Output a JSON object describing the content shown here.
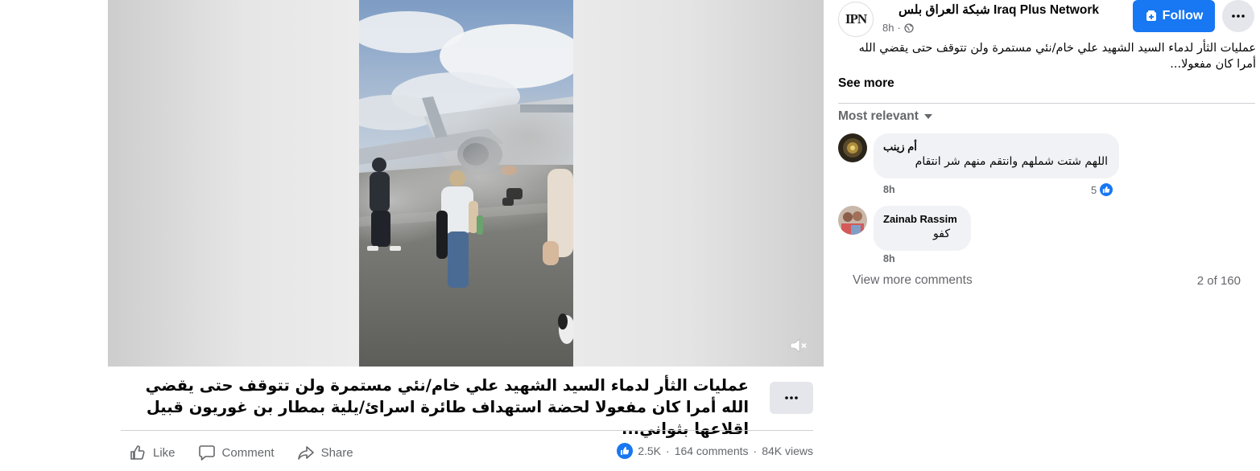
{
  "page": {
    "name": "شبكة العراق بلس Iraq Plus Network",
    "avatar_text": "IPN",
    "time": "8h",
    "audience_icon": "globe-icon"
  },
  "buttons": {
    "follow_label": "Follow",
    "see_more": "See more"
  },
  "post": {
    "text_preview": "عمليات الثأر لدماء السيد الشهيد علي خام/نئي مستمرة ولن تتوقف حتى يقضي الله أمرا كان مفعولا...",
    "caption": "عمليات الثأر لدماء السيد الشهيد علي خام/نئي مستمرة ولن تتوقف حتى يقضي الله أمرا كان مفعولا لحضة استهداف طائرة اسرائ/يلية بمطار بن غوريون قبيل اقلاعها بثواني..."
  },
  "actions": {
    "like": "Like",
    "comment": "Comment",
    "share": "Share"
  },
  "stats": {
    "reactions": "2.5K",
    "comments": "164 comments",
    "views": "84K views",
    "separator": "·"
  },
  "comments_section": {
    "sort_label": "Most relevant",
    "items": [
      {
        "author": "أم زينب",
        "text": "اللهم شتت شملهم وانتقم منهم شر انتقام",
        "time": "8h",
        "reactions": "5"
      },
      {
        "author": "Zainab Rassim",
        "text": "كفو",
        "time": "8h"
      }
    ],
    "view_more": "View more comments",
    "count": "2 of 160"
  },
  "colors": {
    "accent": "#1877f2",
    "bubble": "#f0f2f5",
    "secondary_text": "#65676b"
  }
}
